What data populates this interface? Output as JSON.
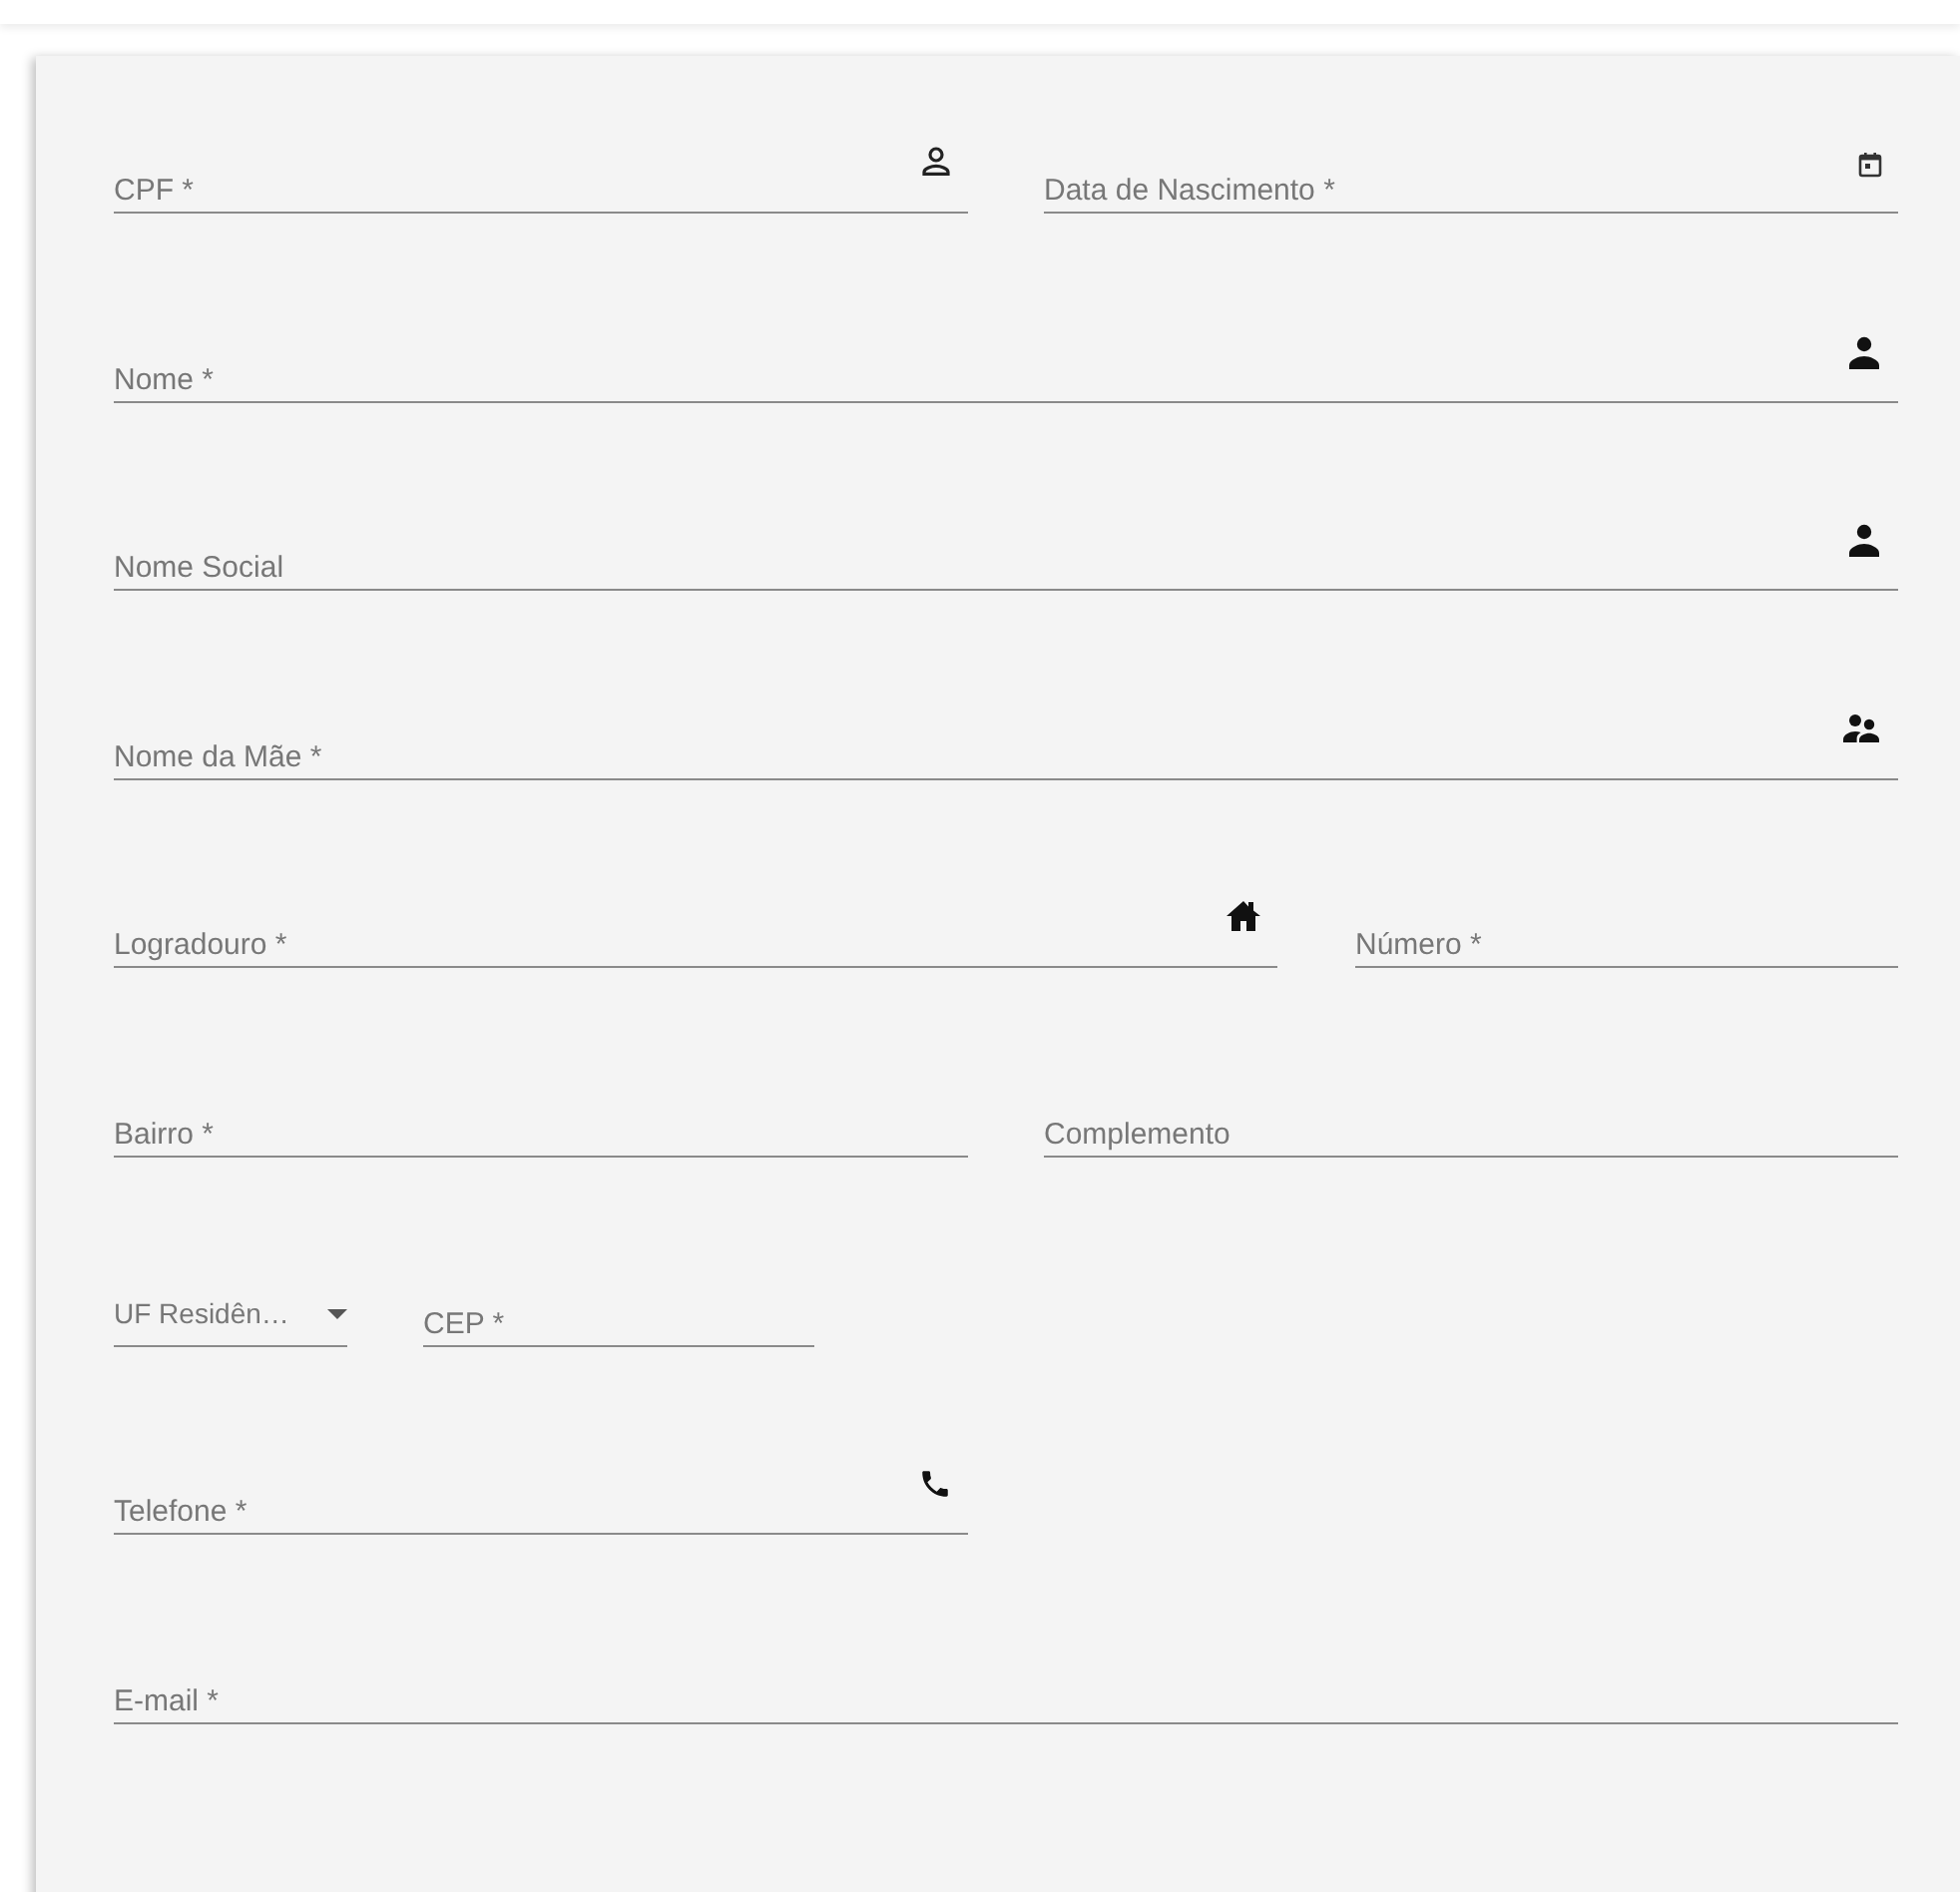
{
  "form": {
    "rows": [
      {
        "fields": [
          {
            "kind": "text",
            "placeholder": "CPF *"
          },
          {
            "kind": "text",
            "placeholder": "Data de Nascimento *"
          }
        ]
      },
      {
        "fields": [
          {
            "kind": "text",
            "placeholder": "Nome *"
          }
        ]
      },
      {
        "fields": [
          {
            "kind": "text",
            "placeholder": "Nome Social"
          }
        ]
      },
      {
        "fields": [
          {
            "kind": "text",
            "placeholder": "Nome da Mãe *"
          }
        ]
      },
      {
        "fields": [
          {
            "kind": "text",
            "placeholder": "Logradouro *"
          },
          {
            "kind": "text",
            "placeholder": "Número *"
          }
        ]
      },
      {
        "fields": [
          {
            "kind": "text",
            "placeholder": "Bairro *"
          },
          {
            "kind": "text",
            "placeholder": "Complemento"
          }
        ]
      },
      {
        "fields": [
          {
            "kind": "select",
            "placeholder": "UF Residên…"
          },
          {
            "kind": "text",
            "placeholder": "CEP *"
          }
        ]
      },
      {
        "fields": [
          {
            "kind": "text",
            "placeholder": "Telefone *"
          }
        ]
      },
      {
        "fields": [
          {
            "kind": "text",
            "placeholder": "E-mail *"
          }
        ]
      }
    ]
  }
}
